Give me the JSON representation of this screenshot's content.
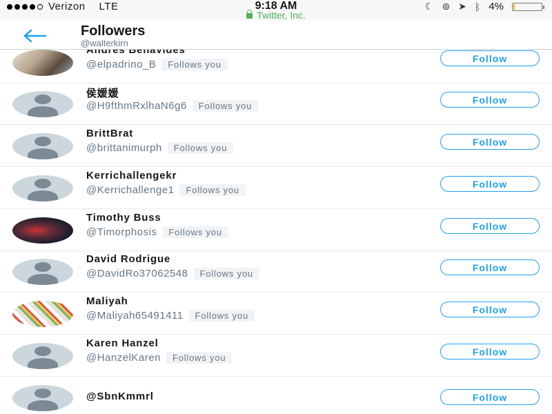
{
  "status_bar": {
    "carrier": "Verizon",
    "network": "LTE",
    "time": "9:18 AM",
    "site": "Twitter, Inc.",
    "battery_percent": "4%",
    "battery_level": 0.04,
    "icons": [
      "moon-icon",
      "orientation-lock-icon",
      "location-icon",
      "bluetooth-icon"
    ]
  },
  "header": {
    "title": "Followers",
    "subtitle": "@walterkirn"
  },
  "followers": [
    {
      "name": "Andres Benavides",
      "handle": "@elpadrino_B",
      "badge": "Follows you",
      "button": "Follow",
      "avatar": "photo"
    },
    {
      "name": "侯媛媛",
      "handle": "@H9fthmRxlhaN6g6",
      "badge": "Follows you",
      "button": "Follow",
      "avatar": "default"
    },
    {
      "name": "BrittBrat",
      "handle": "@brittanimurph",
      "badge": "Follows you",
      "button": "Follow",
      "avatar": "default"
    },
    {
      "name": "Kerrichallengekr",
      "handle": "@Kerrichallenge1",
      "badge": "Follows you",
      "button": "Follow",
      "avatar": "default"
    },
    {
      "name": "Timothy Buss",
      "handle": "@Timorphosis",
      "badge": "Follows you",
      "button": "Follow",
      "avatar": "photo"
    },
    {
      "name": "David Rodrigue",
      "handle": "@DavidRo37062548",
      "badge": "Follows you",
      "button": "Follow",
      "avatar": "default"
    },
    {
      "name": "Maliyah",
      "handle": "@Maliyah65491411",
      "badge": "Follows you",
      "button": "Follow",
      "avatar": "photo"
    },
    {
      "name": "Karen Hanzel",
      "handle": "@HanzelKaren",
      "badge": "Follows you",
      "button": "Follow",
      "avatar": "default"
    },
    {
      "name": "@SbnKmmrl",
      "handle": "",
      "badge": "",
      "button": "Follow",
      "avatar": "default"
    }
  ],
  "colors": {
    "accent": "#1da1f2",
    "secure_green": "#4fb35a",
    "secondary_text": "#657786"
  }
}
